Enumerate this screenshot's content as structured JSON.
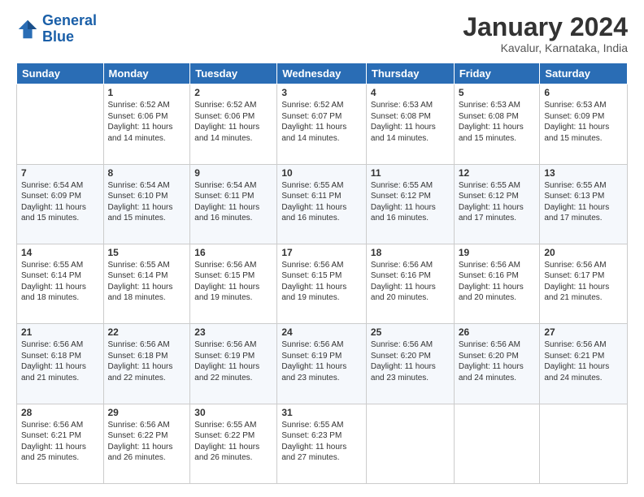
{
  "header": {
    "logo_line1": "General",
    "logo_line2": "Blue",
    "title": "January 2024",
    "subtitle": "Kavalur, Karnataka, India"
  },
  "days": [
    "Sunday",
    "Monday",
    "Tuesday",
    "Wednesday",
    "Thursday",
    "Friday",
    "Saturday"
  ],
  "weeks": [
    [
      {
        "day": "",
        "sunrise": "",
        "sunset": "",
        "daylight": ""
      },
      {
        "day": "1",
        "sunrise": "Sunrise: 6:52 AM",
        "sunset": "Sunset: 6:06 PM",
        "daylight": "Daylight: 11 hours and 14 minutes."
      },
      {
        "day": "2",
        "sunrise": "Sunrise: 6:52 AM",
        "sunset": "Sunset: 6:06 PM",
        "daylight": "Daylight: 11 hours and 14 minutes."
      },
      {
        "day": "3",
        "sunrise": "Sunrise: 6:52 AM",
        "sunset": "Sunset: 6:07 PM",
        "daylight": "Daylight: 11 hours and 14 minutes."
      },
      {
        "day": "4",
        "sunrise": "Sunrise: 6:53 AM",
        "sunset": "Sunset: 6:08 PM",
        "daylight": "Daylight: 11 hours and 14 minutes."
      },
      {
        "day": "5",
        "sunrise": "Sunrise: 6:53 AM",
        "sunset": "Sunset: 6:08 PM",
        "daylight": "Daylight: 11 hours and 15 minutes."
      },
      {
        "day": "6",
        "sunrise": "Sunrise: 6:53 AM",
        "sunset": "Sunset: 6:09 PM",
        "daylight": "Daylight: 11 hours and 15 minutes."
      }
    ],
    [
      {
        "day": "7",
        "sunrise": "Sunrise: 6:54 AM",
        "sunset": "Sunset: 6:09 PM",
        "daylight": "Daylight: 11 hours and 15 minutes."
      },
      {
        "day": "8",
        "sunrise": "Sunrise: 6:54 AM",
        "sunset": "Sunset: 6:10 PM",
        "daylight": "Daylight: 11 hours and 15 minutes."
      },
      {
        "day": "9",
        "sunrise": "Sunrise: 6:54 AM",
        "sunset": "Sunset: 6:11 PM",
        "daylight": "Daylight: 11 hours and 16 minutes."
      },
      {
        "day": "10",
        "sunrise": "Sunrise: 6:55 AM",
        "sunset": "Sunset: 6:11 PM",
        "daylight": "Daylight: 11 hours and 16 minutes."
      },
      {
        "day": "11",
        "sunrise": "Sunrise: 6:55 AM",
        "sunset": "Sunset: 6:12 PM",
        "daylight": "Daylight: 11 hours and 16 minutes."
      },
      {
        "day": "12",
        "sunrise": "Sunrise: 6:55 AM",
        "sunset": "Sunset: 6:12 PM",
        "daylight": "Daylight: 11 hours and 17 minutes."
      },
      {
        "day": "13",
        "sunrise": "Sunrise: 6:55 AM",
        "sunset": "Sunset: 6:13 PM",
        "daylight": "Daylight: 11 hours and 17 minutes."
      }
    ],
    [
      {
        "day": "14",
        "sunrise": "Sunrise: 6:55 AM",
        "sunset": "Sunset: 6:14 PM",
        "daylight": "Daylight: 11 hours and 18 minutes."
      },
      {
        "day": "15",
        "sunrise": "Sunrise: 6:55 AM",
        "sunset": "Sunset: 6:14 PM",
        "daylight": "Daylight: 11 hours and 18 minutes."
      },
      {
        "day": "16",
        "sunrise": "Sunrise: 6:56 AM",
        "sunset": "Sunset: 6:15 PM",
        "daylight": "Daylight: 11 hours and 19 minutes."
      },
      {
        "day": "17",
        "sunrise": "Sunrise: 6:56 AM",
        "sunset": "Sunset: 6:15 PM",
        "daylight": "Daylight: 11 hours and 19 minutes."
      },
      {
        "day": "18",
        "sunrise": "Sunrise: 6:56 AM",
        "sunset": "Sunset: 6:16 PM",
        "daylight": "Daylight: 11 hours and 20 minutes."
      },
      {
        "day": "19",
        "sunrise": "Sunrise: 6:56 AM",
        "sunset": "Sunset: 6:16 PM",
        "daylight": "Daylight: 11 hours and 20 minutes."
      },
      {
        "day": "20",
        "sunrise": "Sunrise: 6:56 AM",
        "sunset": "Sunset: 6:17 PM",
        "daylight": "Daylight: 11 hours and 21 minutes."
      }
    ],
    [
      {
        "day": "21",
        "sunrise": "Sunrise: 6:56 AM",
        "sunset": "Sunset: 6:18 PM",
        "daylight": "Daylight: 11 hours and 21 minutes."
      },
      {
        "day": "22",
        "sunrise": "Sunrise: 6:56 AM",
        "sunset": "Sunset: 6:18 PM",
        "daylight": "Daylight: 11 hours and 22 minutes."
      },
      {
        "day": "23",
        "sunrise": "Sunrise: 6:56 AM",
        "sunset": "Sunset: 6:19 PM",
        "daylight": "Daylight: 11 hours and 22 minutes."
      },
      {
        "day": "24",
        "sunrise": "Sunrise: 6:56 AM",
        "sunset": "Sunset: 6:19 PM",
        "daylight": "Daylight: 11 hours and 23 minutes."
      },
      {
        "day": "25",
        "sunrise": "Sunrise: 6:56 AM",
        "sunset": "Sunset: 6:20 PM",
        "daylight": "Daylight: 11 hours and 23 minutes."
      },
      {
        "day": "26",
        "sunrise": "Sunrise: 6:56 AM",
        "sunset": "Sunset: 6:20 PM",
        "daylight": "Daylight: 11 hours and 24 minutes."
      },
      {
        "day": "27",
        "sunrise": "Sunrise: 6:56 AM",
        "sunset": "Sunset: 6:21 PM",
        "daylight": "Daylight: 11 hours and 24 minutes."
      }
    ],
    [
      {
        "day": "28",
        "sunrise": "Sunrise: 6:56 AM",
        "sunset": "Sunset: 6:21 PM",
        "daylight": "Daylight: 11 hours and 25 minutes."
      },
      {
        "day": "29",
        "sunrise": "Sunrise: 6:56 AM",
        "sunset": "Sunset: 6:22 PM",
        "daylight": "Daylight: 11 hours and 26 minutes."
      },
      {
        "day": "30",
        "sunrise": "Sunrise: 6:55 AM",
        "sunset": "Sunset: 6:22 PM",
        "daylight": "Daylight: 11 hours and 26 minutes."
      },
      {
        "day": "31",
        "sunrise": "Sunrise: 6:55 AM",
        "sunset": "Sunset: 6:23 PM",
        "daylight": "Daylight: 11 hours and 27 minutes."
      },
      {
        "day": "",
        "sunrise": "",
        "sunset": "",
        "daylight": ""
      },
      {
        "day": "",
        "sunrise": "",
        "sunset": "",
        "daylight": ""
      },
      {
        "day": "",
        "sunrise": "",
        "sunset": "",
        "daylight": ""
      }
    ]
  ]
}
